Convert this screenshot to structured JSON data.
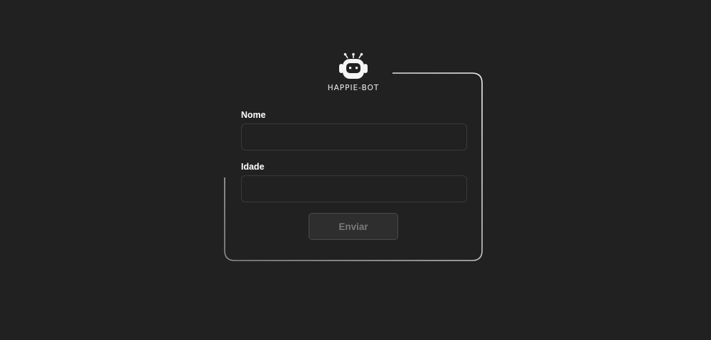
{
  "logo": {
    "icon": "robot-icon",
    "text": "HAPPIE-BOT"
  },
  "form": {
    "name_label": "Nome",
    "name_value": "",
    "name_placeholder": "",
    "age_label": "Idade",
    "age_value": "",
    "age_placeholder": "",
    "submit_label": "Enviar"
  },
  "colors": {
    "background": "#212121",
    "card_border_light": "#e6e6e6",
    "label_text": "#ffffff",
    "input_border": "#3a3a3a",
    "button_bg": "#2e2e2e",
    "button_text": "#7a7a7a"
  }
}
